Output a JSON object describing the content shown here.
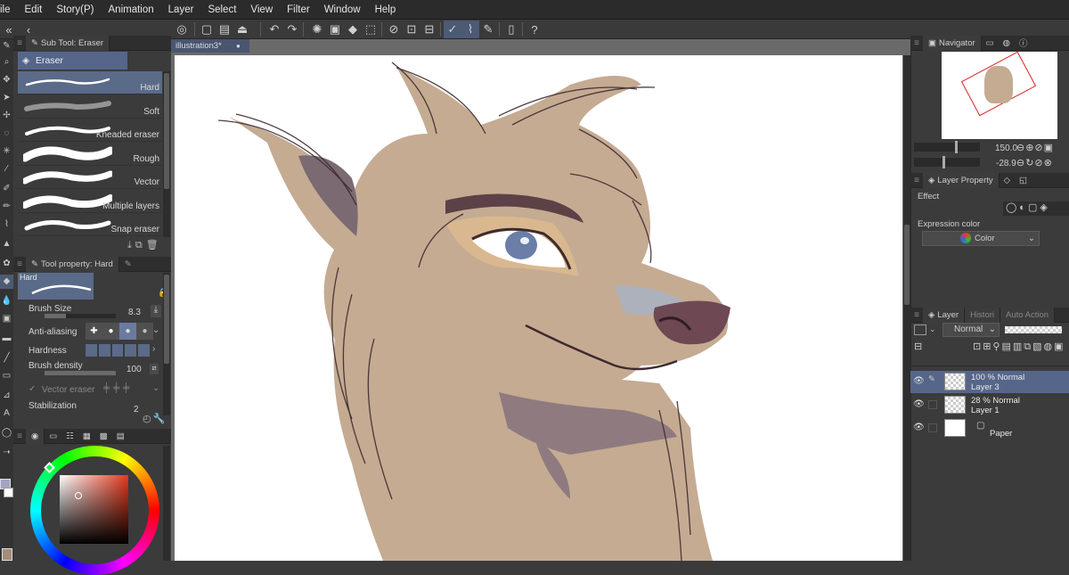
{
  "menu": [
    "ile",
    "Edit",
    "Story(P)",
    "Animation",
    "Layer",
    "Select",
    "View",
    "Filter",
    "Window",
    "Help"
  ],
  "subtool": {
    "tab_label": "Sub Tool: Eraser",
    "group_label": "Eraser",
    "brushes": [
      "Hard",
      "Soft",
      "Kneaded eraser",
      "Rough",
      "Vector",
      "Multiple layers",
      "Snap eraser"
    ]
  },
  "tool_property": {
    "tab_label": "Tool property: Hard",
    "preview_label": "Hard",
    "brush_size_label": "Brush Size",
    "brush_size_value": "8.3",
    "antialiasing_label": "Anti-aliasing",
    "hardness_label": "Hardness",
    "brush_density_label": "Brush density",
    "brush_density_value": "100",
    "vector_eraser_label": "Vector eraser",
    "stabilization_label": "Stabilization",
    "stabilization_value": "2"
  },
  "document": {
    "tab_label": "illustration3*"
  },
  "navigator": {
    "tab_label": "Navigator",
    "zoom_value": "150.0",
    "rotation_value": "-28.9"
  },
  "layer_property": {
    "tab_label": "Layer Property",
    "effect_label": "Effect",
    "expression_color_label": "Expression color",
    "expression_color_value": "Color"
  },
  "layers_panel": {
    "tabs": [
      "Layer",
      "Histori",
      "Auto Action"
    ],
    "blend_mode": "Normal",
    "layers": [
      {
        "opacity_mode": "100 % Normal",
        "name": "Layer 3",
        "selected": true
      },
      {
        "opacity_mode": "28 % Normal",
        "name": "Layer 1",
        "selected": false
      },
      {
        "opacity_mode": "",
        "name": "Paper",
        "selected": false
      }
    ]
  },
  "colors": {
    "accent": "#56668a",
    "fur": "#c4ab92",
    "fur_dark": "#a58d79",
    "line": "#3e2a2e",
    "eye": "#6b7ea8"
  }
}
